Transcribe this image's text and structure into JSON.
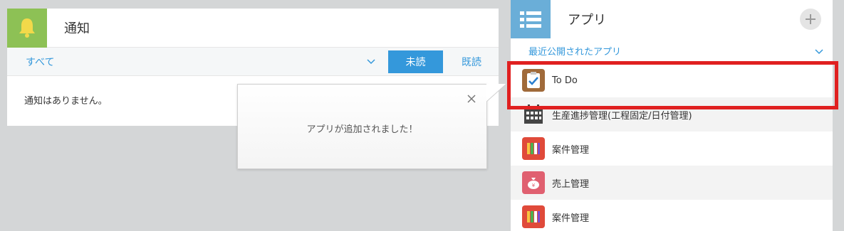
{
  "notifications": {
    "title": "通知",
    "filter_label": "すべて",
    "tab_unread": "未読",
    "tab_read": "既読",
    "empty_message": "通知はありません。"
  },
  "popup": {
    "message": "アプリが追加されました！"
  },
  "apps": {
    "title": "アプリ",
    "filter_label": "最近公開されたアプリ",
    "items": [
      {
        "name": "To Do",
        "icon": "todo-clipboard-icon",
        "color": "#a06a3a"
      },
      {
        "name": "生産進捗管理(工程固定/日付管理)",
        "icon": "calendar-icon",
        "color": "#444444"
      },
      {
        "name": "案件管理",
        "icon": "binders-icon",
        "color": "#e04a3a"
      },
      {
        "name": "売上管理",
        "icon": "money-bag-icon",
        "color": "#e06070"
      },
      {
        "name": "案件管理",
        "icon": "binders-icon",
        "color": "#e04a3a"
      }
    ]
  },
  "colors": {
    "accent": "#3498db",
    "notif_header": "#8dc155",
    "apps_header": "#6aaed8",
    "highlight": "#e02020"
  }
}
